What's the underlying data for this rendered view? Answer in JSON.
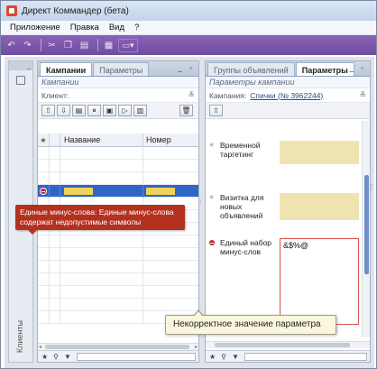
{
  "window": {
    "title": "Директ Коммандер (бета)"
  },
  "menu": {
    "items": [
      "Приложение",
      "Правка",
      "Вид",
      "?"
    ]
  },
  "toolbar": {
    "icons": [
      "undo-icon",
      "redo-icon",
      "cut-icon",
      "copy-icon",
      "paste-icon",
      "grid-icon",
      "layout-dropdown-icon"
    ]
  },
  "left_dock": {
    "label": "Клиенты"
  },
  "left_panel": {
    "tabs": [
      "Кампании",
      "Параметры"
    ],
    "active_tab": "Кампании",
    "subtitle": "Кампании",
    "client_label": "Клиент:",
    "columns": {
      "name": "Название",
      "number": "Номер"
    },
    "error_tooltip": "Единые минус-слова: Единые минус-слова содержат недопустимые символы"
  },
  "right_panel": {
    "tabs": [
      "Группы объявлений",
      "Параметры"
    ],
    "active_tab": "Параметры",
    "subtitle": "Параметры кампании",
    "campaign_label": "Кампания:",
    "campaign_link": "Спички (№ 3962244)",
    "fields": [
      {
        "label": "Временной таргетинг",
        "value": ""
      },
      {
        "label": "Визитка для новых объявлений",
        "value": ""
      },
      {
        "label": "Единый набор минус-слов",
        "value": "&$%@",
        "error": true
      }
    ],
    "hint": "Некорректное значение параметра"
  },
  "colors": {
    "accent_toolbar": "#7a56ad",
    "selection": "#2e66c5",
    "error": "#b4301f",
    "highlight_field": "#efe3b2"
  }
}
